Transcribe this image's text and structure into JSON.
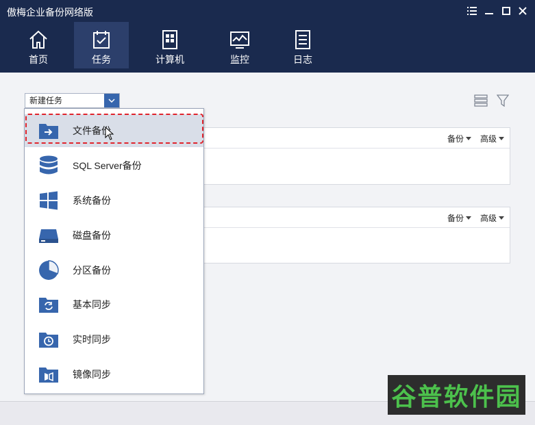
{
  "app": {
    "title": "傲梅企业备份网络版"
  },
  "nav": {
    "tabs": [
      {
        "label": "首页",
        "icon": "home-icon"
      },
      {
        "label": "任务",
        "icon": "task-icon",
        "active": true
      },
      {
        "label": "计算机",
        "icon": "computer-icon"
      },
      {
        "label": "监控",
        "icon": "monitor-icon"
      },
      {
        "label": "日志",
        "icon": "log-icon"
      }
    ]
  },
  "toolbar": {
    "new_task_label": "新建任务"
  },
  "panels": {
    "backup_label": "备份",
    "advanced_label": "高级"
  },
  "menu": {
    "items": [
      {
        "label": "文件备份",
        "icon": "folder-arrow-icon"
      },
      {
        "label": "SQL Server备份",
        "icon": "database-icon"
      },
      {
        "label": "系统备份",
        "icon": "windows-icon"
      },
      {
        "label": "磁盘备份",
        "icon": "disk-icon"
      },
      {
        "label": "分区备份",
        "icon": "pie-icon"
      },
      {
        "label": "基本同步",
        "icon": "sync-folder-icon"
      },
      {
        "label": "实时同步",
        "icon": "clock-folder-icon"
      },
      {
        "label": "镜像同步",
        "icon": "mirror-folder-icon"
      }
    ]
  },
  "watermark": {
    "text": "谷普软件园"
  },
  "colors": {
    "header": "#1a2a4e",
    "accent": "#3766ad",
    "highlight": "#e0232b"
  }
}
